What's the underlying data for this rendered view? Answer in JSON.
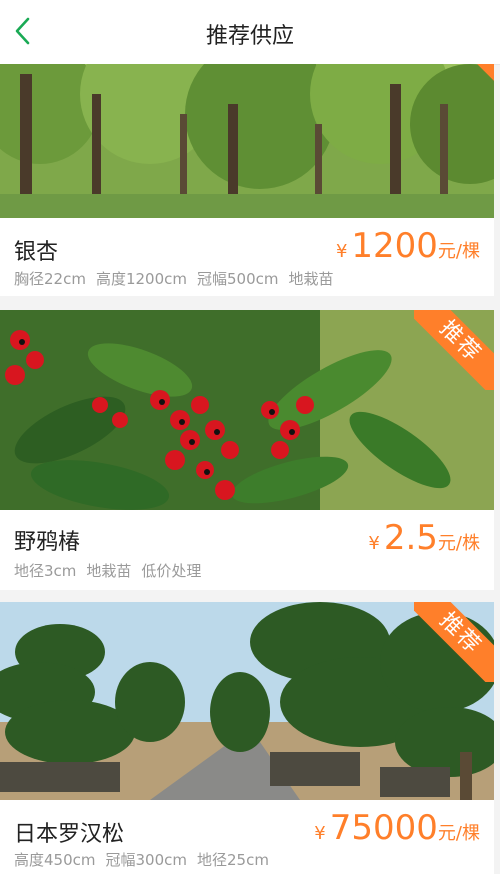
{
  "header": {
    "title": "推荐供应",
    "back_icon": "chevron-left-icon",
    "accent": "#1aaa55"
  },
  "ribbon_color": "#ff7f2a",
  "items": [
    {
      "name": "银杏",
      "specs": [
        "胸径22cm",
        "高度1200cm",
        "冠幅500cm",
        "地栽苗"
      ],
      "currency": "¥",
      "price": "1200",
      "unit": "元/棵",
      "badge": ""
    },
    {
      "name": "野鸦椿",
      "specs": [
        "地径3cm",
        "地栽苗",
        "低价处理"
      ],
      "currency": "¥",
      "price": "2.5",
      "unit": "元/株",
      "badge": "推荐"
    },
    {
      "name": "日本罗汉松",
      "specs": [
        "高度450cm",
        "冠幅300cm",
        "地径25cm"
      ],
      "currency": "¥",
      "price": "75000",
      "unit": "元/棵",
      "badge": "推荐"
    }
  ]
}
